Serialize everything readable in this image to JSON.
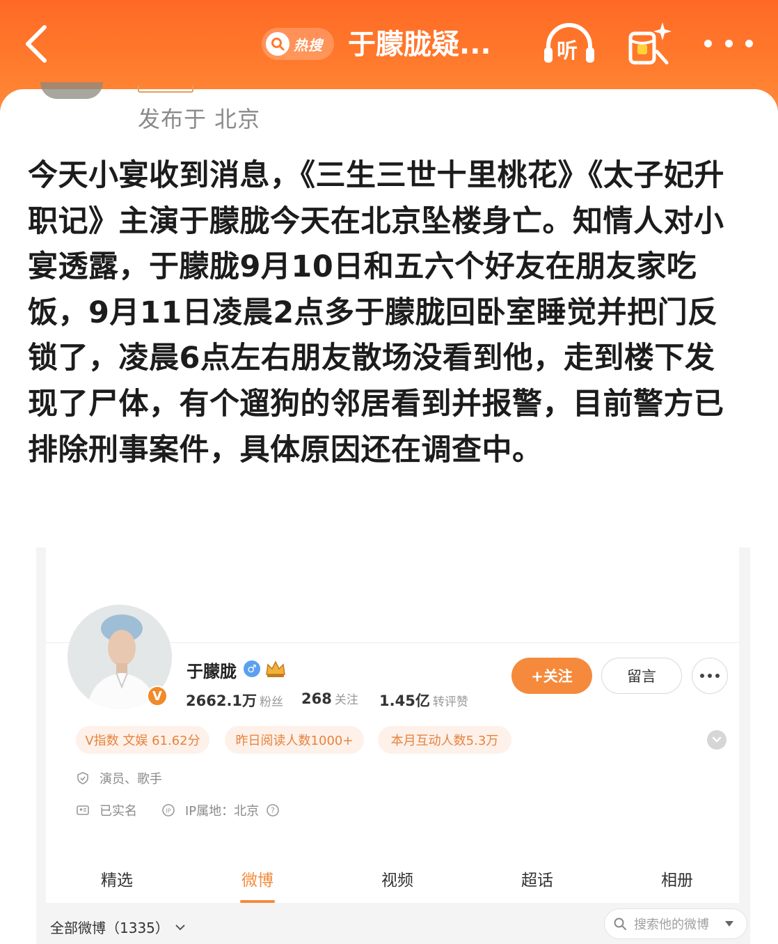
{
  "header": {
    "hot_search_label": "热搜",
    "title": "于朦胧疑...",
    "listen_label": "听",
    "colors": {
      "background": "#ff7a2c",
      "foreground": "#ffffff"
    }
  },
  "post": {
    "location": "发布于 北京",
    "body": "今天小宴收到消息，《三生三世十里桃花》《太子妃升职记》主演于朦胧今天在北京坠楼身亡。知情人对小宴透露，于朦胧9月10日和五六个好友在朋友家吃饭，9月11日凌晨2点多于朦胧回卧室睡觉并把门反锁了，凌晨6点左右朋友散场没看到他，走到楼下发现了尸体，有个遛狗的邻居看到并报警，目前警方已排除刑事案件，具体原因还在调查中。"
  },
  "profile": {
    "name": "于朦胧",
    "gender_symbol": "♂",
    "verified_mark": "V",
    "stats": [
      {
        "value": "2662.1万",
        "unit": "粉丝"
      },
      {
        "value": "268",
        "unit": "关注"
      },
      {
        "value": "1.45亿",
        "unit": "转评赞"
      }
    ],
    "follow_label": "+关注",
    "message_label": "留言",
    "tags": [
      "V指数 文娱 61.62分",
      "昨日阅读人数1000+",
      "本月互动人数5.3万"
    ],
    "occupation": "演员、歌手",
    "real_name": "已实名",
    "ip_location": "IP属地：北京",
    "tabs": [
      "精选",
      "微博",
      "视频",
      "超话",
      "相册"
    ],
    "active_tab": "微博",
    "all_posts": "全部微博（1335）",
    "search_placeholder": "搜索他的微博",
    "accent_color": "#f58a3c"
  }
}
